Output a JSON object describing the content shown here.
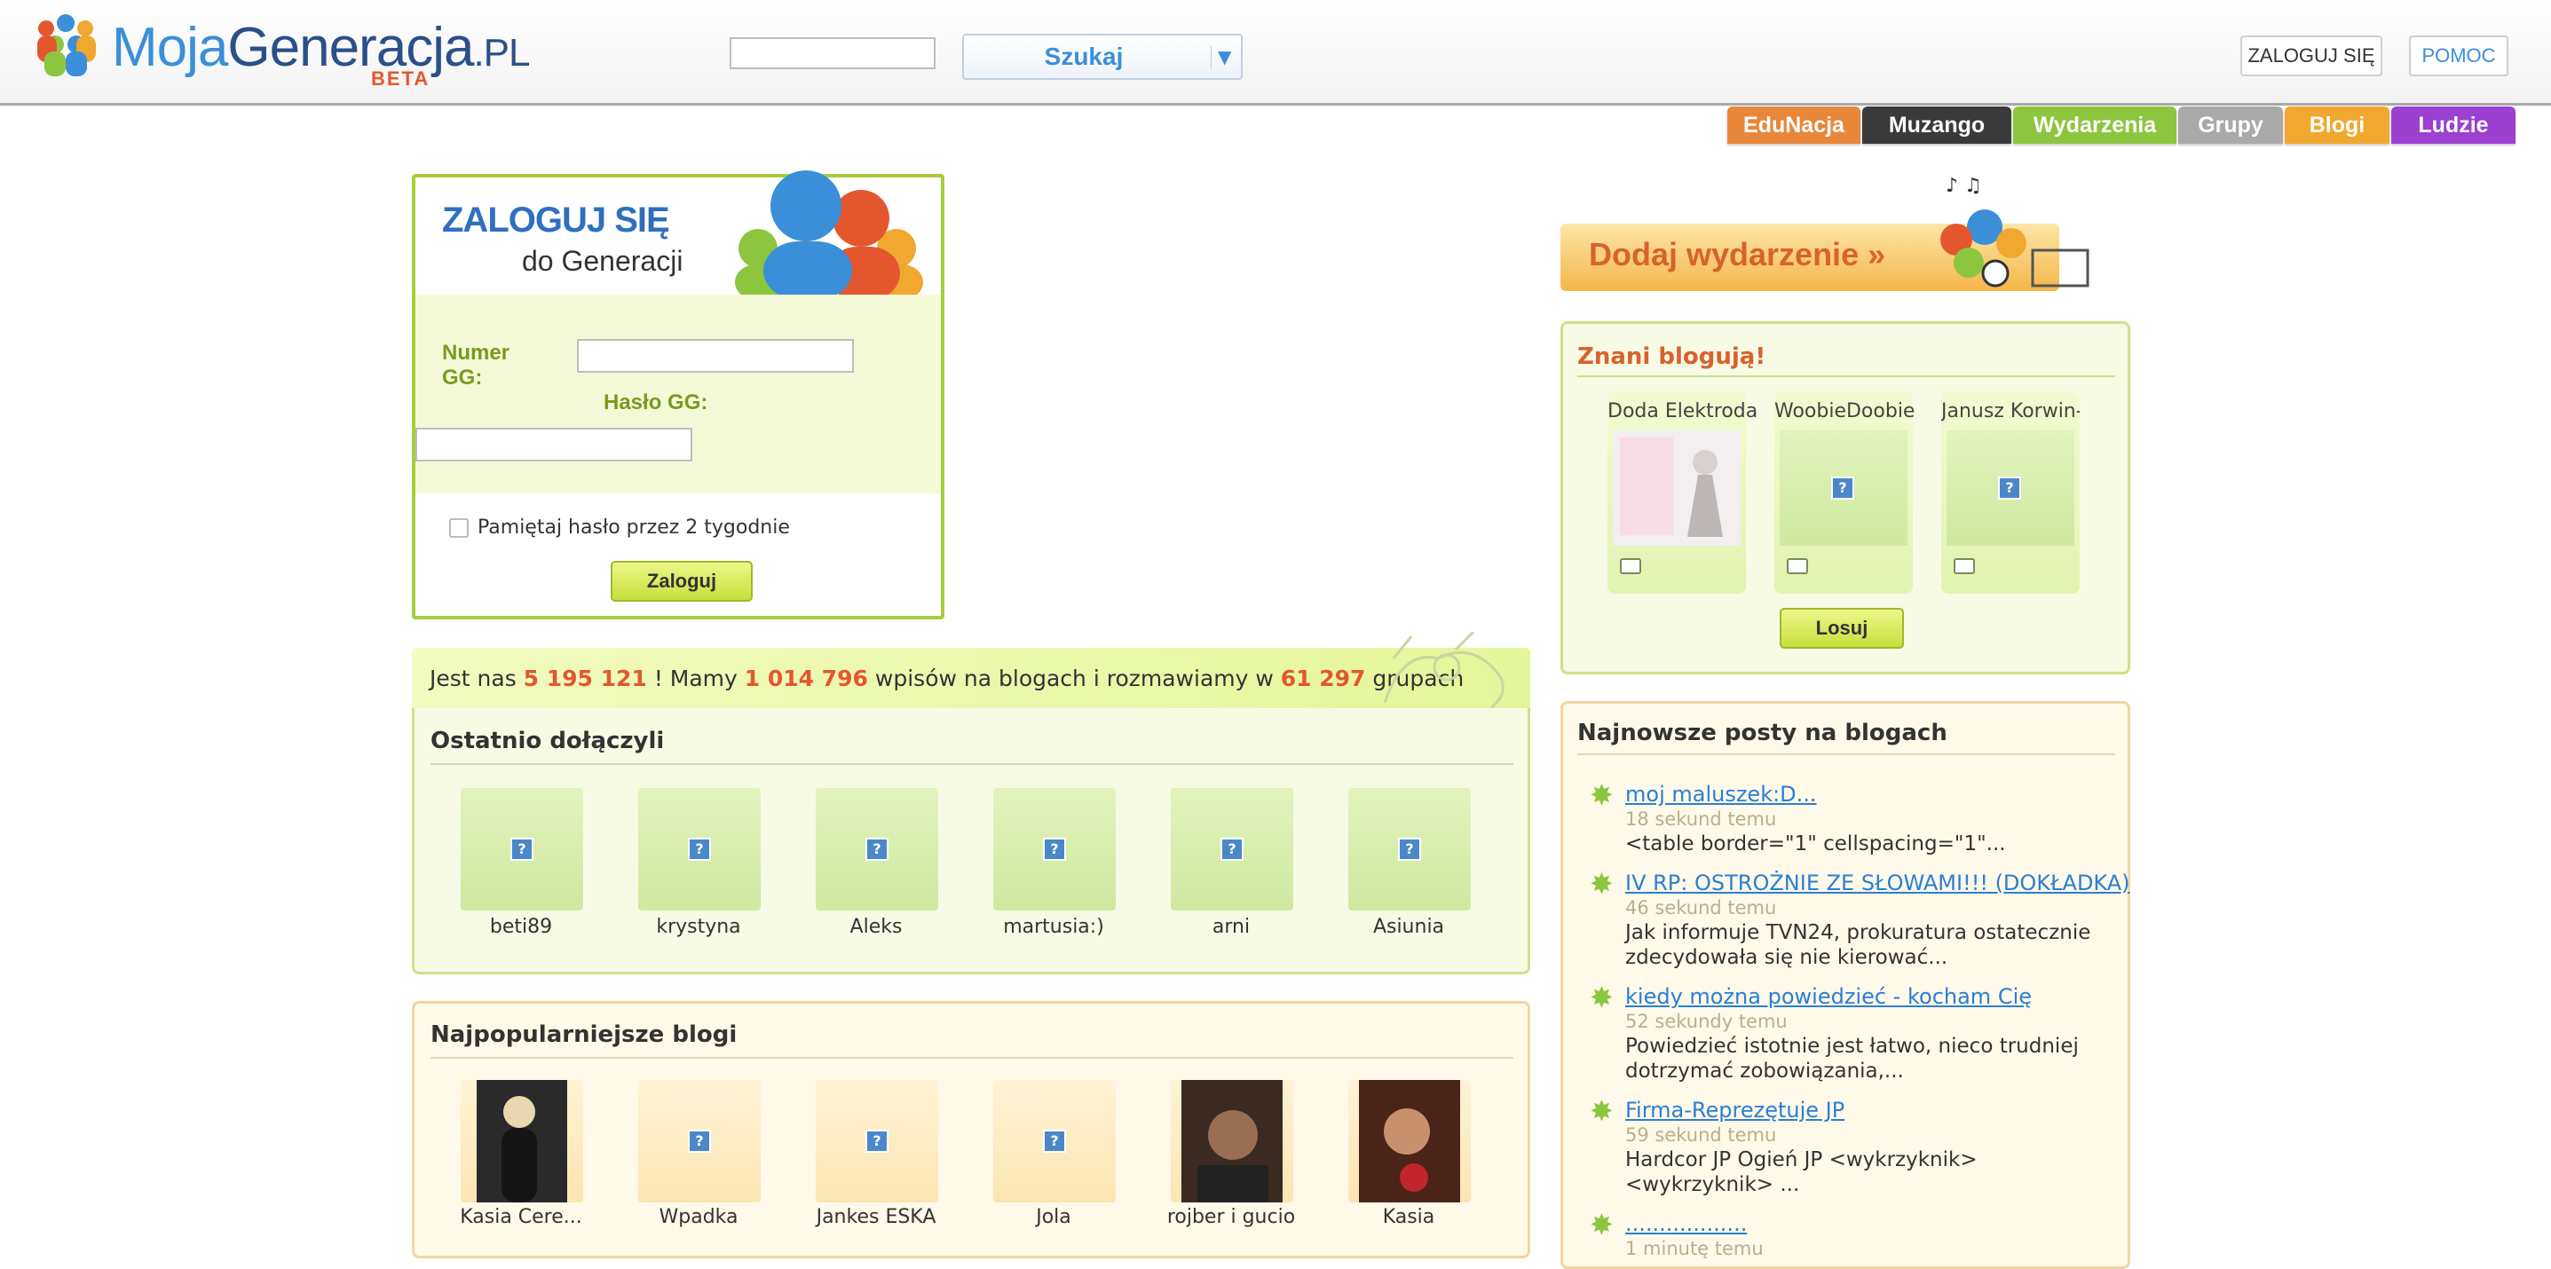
{
  "header": {
    "logo_moja": "Moja",
    "logo_generacja": "Generacja",
    "logo_pl": ".PL",
    "logo_beta": "BETA",
    "search_value": "",
    "search_button": "Szukaj",
    "login_button": "ZALOGUJ SIĘ",
    "help_button": "POMOC"
  },
  "tabs": [
    {
      "label": "EduNacja",
      "color": "#e8873a"
    },
    {
      "label": "Muzango",
      "color": "#3a3a3a"
    },
    {
      "label": "Wydarzenia",
      "color": "#8cc63f"
    },
    {
      "label": "Grupy",
      "color": "#a9a9a9"
    },
    {
      "label": "Blogi",
      "color": "#f0a830"
    },
    {
      "label": "Ludzie",
      "color": "#9b40d0"
    }
  ],
  "login": {
    "title": "ZALOGUJ SIĘ",
    "subtitle": "do Generacji",
    "gg_number_label": "Numer GG:",
    "gg_password_label": "Hasło GG:",
    "gg_number_value": "",
    "gg_password_value": "",
    "remember_label": "Pamiętaj hasło przez 2 tygodnie",
    "submit": "Zaloguj"
  },
  "stats": {
    "t1": "Jest nas",
    "users": "5 195 121",
    "t2": "! Mamy",
    "entries": "1 014 796",
    "t3": "wpisów na blogach i rozmawiamy w",
    "groups": "61 297",
    "t4": "grupach"
  },
  "recent": {
    "title": "Ostatnio dołączyli",
    "users": [
      "beti89",
      "krystyna",
      "Aleks",
      "martusia:)",
      "arni",
      "Asiunia"
    ]
  },
  "popular": {
    "title": "Najpopularniejsze blogi",
    "blogs": [
      "Kasia Cere...",
      "Wpadka",
      "Jankes ESKA",
      "Jola",
      "rojber i gucio",
      "Kasia"
    ]
  },
  "add_event": {
    "label": "Dodaj wydarzenie »"
  },
  "famous": {
    "title": "Znani blogują!",
    "bloggers": [
      "Doda Elektroda",
      "WoobieDoobie",
      "Janusz Korwin-"
    ],
    "random_button": "Losuj"
  },
  "latest_posts": {
    "title": "Najnowsze posty na blogach",
    "posts": [
      {
        "title": "moj maluszek:D...",
        "time": "18 sekund temu",
        "excerpt": "<table  border=\"1\" cellspacing=\"1\"..."
      },
      {
        "title": "IV RP: OSTROŻNIE ZE SŁOWAMI!!! (DOKŁADKA)",
        "time": "46 sekund temu",
        "excerpt": "Jak informuje TVN24, prokuratura ostatecznie zdecydowała się nie kierować..."
      },
      {
        "title": "kiedy można powiedzieć - kocham Cię",
        "time": "52 sekundy temu",
        "excerpt": "Powiedzieć istotnie jest łatwo, nieco trudniej dotrzymać zobowiązania,..."
      },
      {
        "title": "Firma-Reprezętuje JP",
        "time": "59 sekund temu",
        "excerpt": "Hardcor JP Ogień JP <wykrzyknik><wykrzyknik> ..."
      },
      {
        "title": "..................",
        "time": "1 minutę temu",
        "excerpt": ""
      }
    ]
  }
}
